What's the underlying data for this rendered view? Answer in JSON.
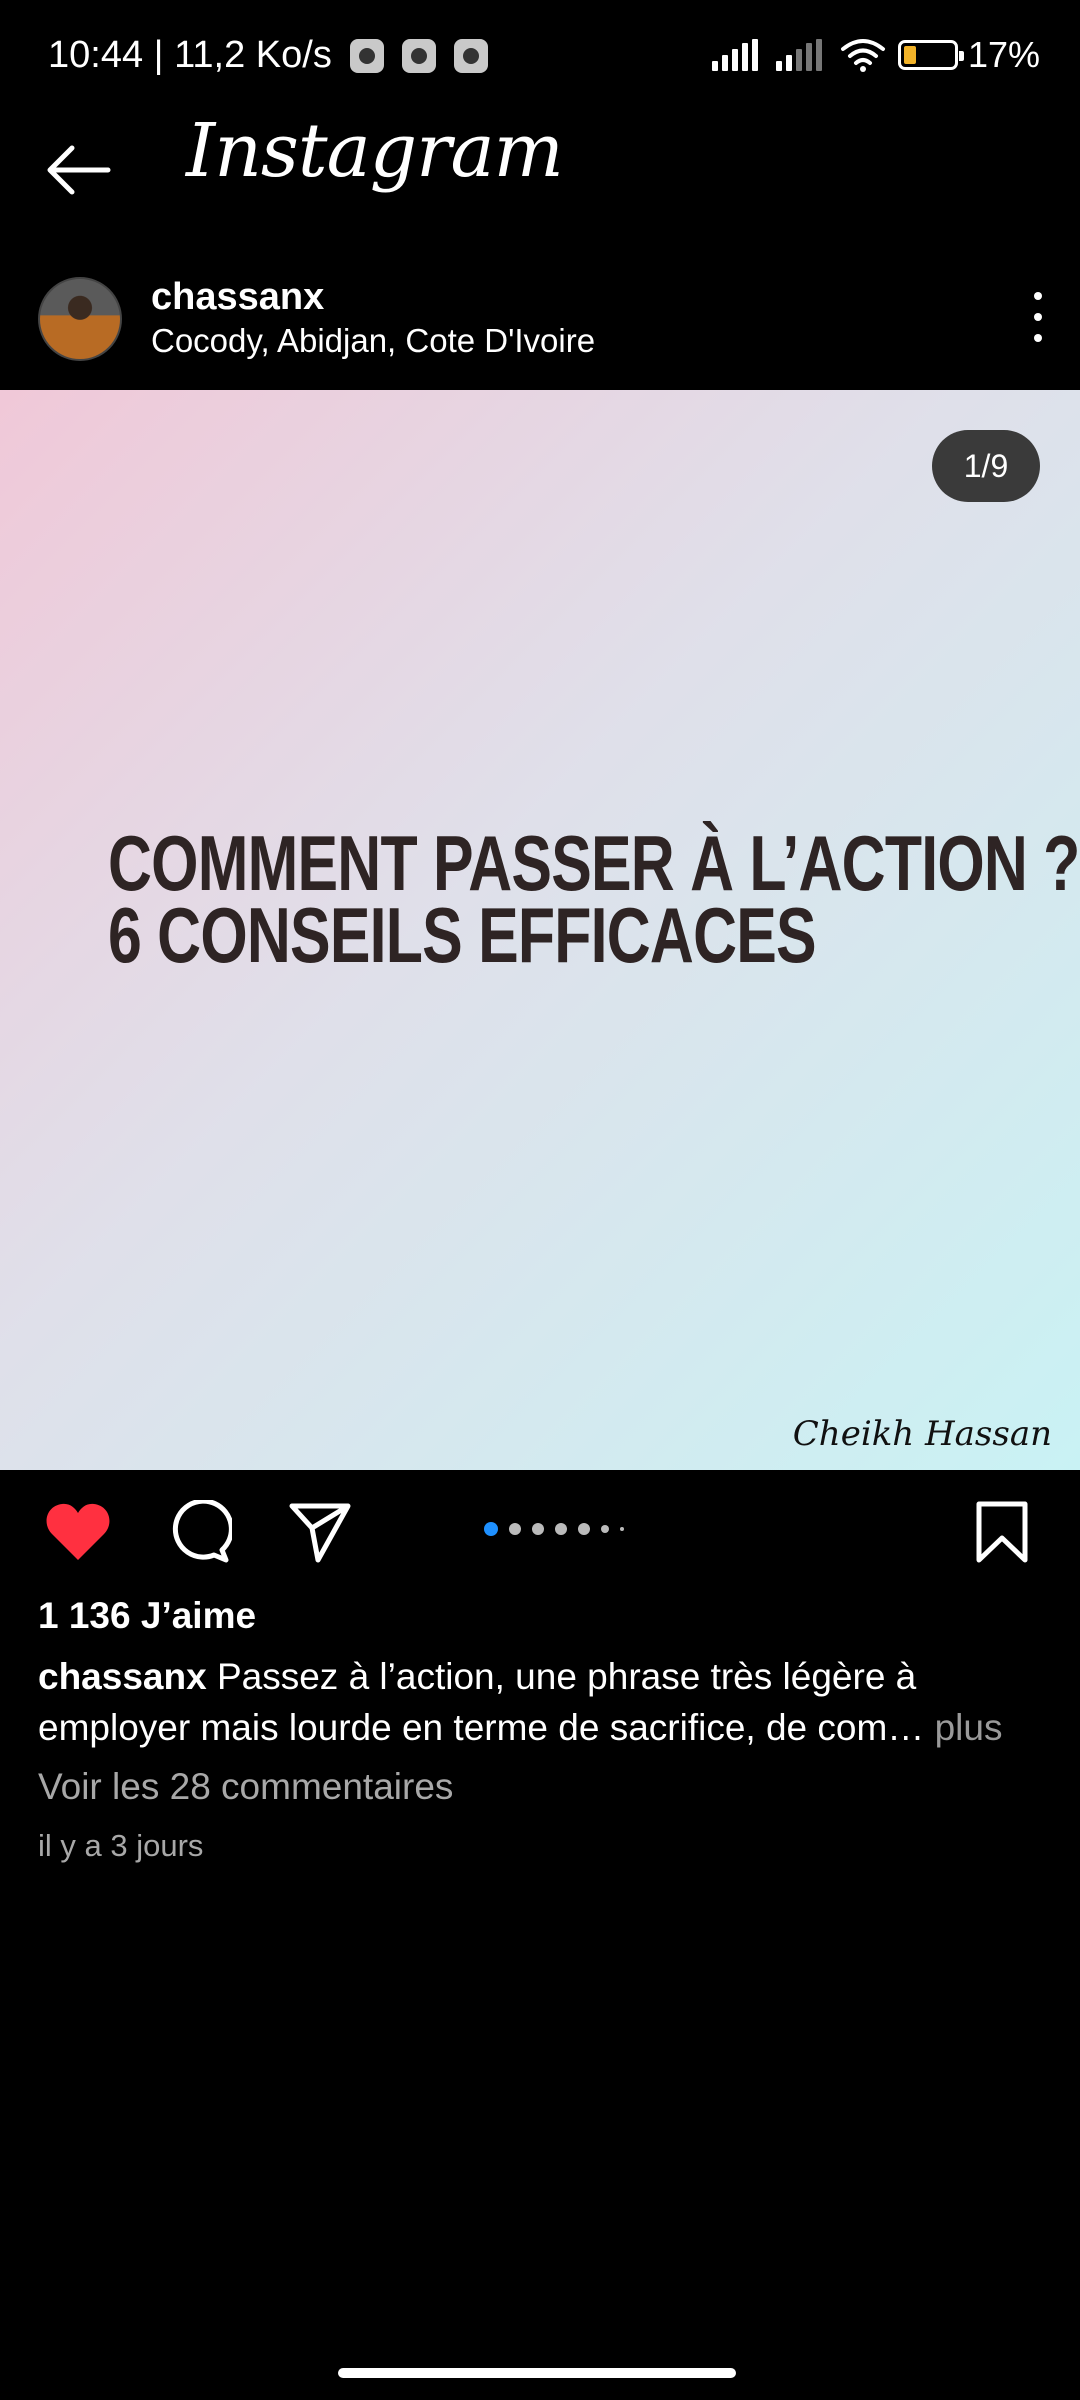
{
  "status_bar": {
    "time_speed": "10:44 | 11,2 Ko/s",
    "battery": "17%"
  },
  "app": {
    "title": "Instagram"
  },
  "post": {
    "username": "chassanx",
    "location": "Cocody, Abidjan, Cote D'Ivoire",
    "image_counter": "1/9",
    "headline_line1": "COMMENT PASSER À L’ACTION ?",
    "headline_line2": "6 CONSEILS EFFICACES",
    "signature": "Cheikh Hassan",
    "likes": "1 136 J’aime",
    "caption_user": "chassanx",
    "caption_text": "Passez à l’action, une phrase très légère à employer mais lourde en terme de sacrifice, de com…",
    "caption_more": "plus",
    "comments_link": "Voir les 28 commentaires",
    "time": "il y a 3 jours",
    "liked": true
  },
  "colors": {
    "like_red": "#ff3040",
    "active_dot": "#1e90ff"
  },
  "icons": [
    "back-arrow-icon",
    "more-options-icon",
    "heart-icon",
    "comment-icon",
    "share-icon",
    "bookmark-icon"
  ]
}
